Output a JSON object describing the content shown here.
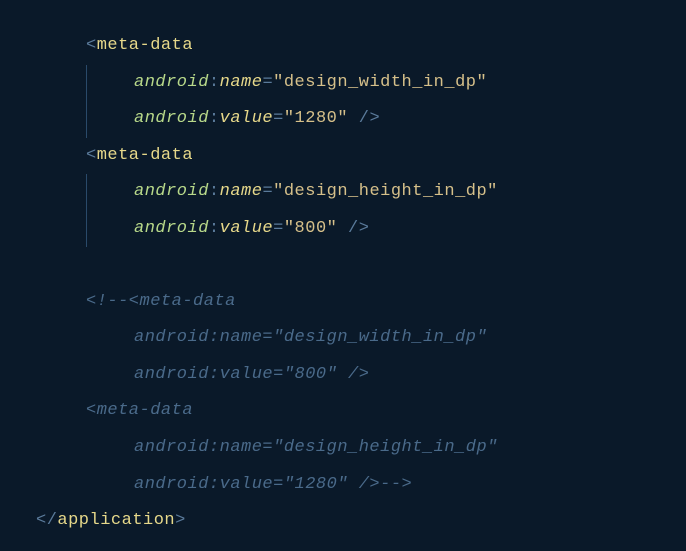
{
  "code": {
    "lines": [
      {
        "indent": 1,
        "vbar": false,
        "segments": [
          {
            "cls": "punct",
            "t": "<"
          },
          {
            "cls": "tag",
            "t": "meta-data"
          }
        ]
      },
      {
        "indent": 2,
        "vbar": true,
        "segments": [
          {
            "cls": "ns",
            "t": "android"
          },
          {
            "cls": "punct",
            "t": ":"
          },
          {
            "cls": "attr",
            "t": "name"
          },
          {
            "cls": "eq",
            "t": "="
          },
          {
            "cls": "str",
            "t": "\"design_width_in_dp\""
          }
        ]
      },
      {
        "indent": 2,
        "vbar": true,
        "segments": [
          {
            "cls": "ns",
            "t": "android"
          },
          {
            "cls": "punct",
            "t": ":"
          },
          {
            "cls": "attr",
            "t": "value"
          },
          {
            "cls": "eq",
            "t": "="
          },
          {
            "cls": "str",
            "t": "\"1280\""
          },
          {
            "cls": "punct",
            "t": " />"
          }
        ]
      },
      {
        "indent": 1,
        "vbar": false,
        "segments": [
          {
            "cls": "punct",
            "t": "<"
          },
          {
            "cls": "tag",
            "t": "meta-data"
          }
        ]
      },
      {
        "indent": 2,
        "vbar": true,
        "segments": [
          {
            "cls": "ns",
            "t": "android"
          },
          {
            "cls": "punct",
            "t": ":"
          },
          {
            "cls": "attr",
            "t": "name"
          },
          {
            "cls": "eq",
            "t": "="
          },
          {
            "cls": "str",
            "t": "\"design_height_in_dp\""
          }
        ]
      },
      {
        "indent": 2,
        "vbar": true,
        "segments": [
          {
            "cls": "ns",
            "t": "android"
          },
          {
            "cls": "punct",
            "t": ":"
          },
          {
            "cls": "attr",
            "t": "value"
          },
          {
            "cls": "eq",
            "t": "="
          },
          {
            "cls": "str",
            "t": "\"800\""
          },
          {
            "cls": "punct",
            "t": " />"
          }
        ]
      },
      {
        "indent": 1,
        "vbar": false,
        "segments": [
          {
            "cls": "punct",
            "t": " "
          }
        ]
      },
      {
        "indent": 1,
        "vbar": false,
        "segments": [
          {
            "cls": "comment",
            "t": "<!--<meta-data"
          }
        ]
      },
      {
        "indent": 2,
        "vbar": false,
        "segments": [
          {
            "cls": "comment",
            "t": "android:name=\"design_width_in_dp\""
          }
        ]
      },
      {
        "indent": 2,
        "vbar": false,
        "segments": [
          {
            "cls": "comment",
            "t": "android:value=\"800\" />"
          }
        ]
      },
      {
        "indent": 1,
        "vbar": false,
        "segments": [
          {
            "cls": "comment",
            "t": "<meta-data"
          }
        ]
      },
      {
        "indent": 2,
        "vbar": false,
        "segments": [
          {
            "cls": "comment",
            "t": "android:name=\"design_height_in_dp\""
          }
        ]
      },
      {
        "indent": 2,
        "vbar": false,
        "segments": [
          {
            "cls": "comment",
            "t": "android:value=\"1280\" />-->"
          }
        ]
      },
      {
        "indent": 0,
        "vbar": false,
        "segments": [
          {
            "cls": "punct",
            "t": "</"
          },
          {
            "cls": "tag",
            "t": "application"
          },
          {
            "cls": "punct",
            "t": ">"
          }
        ]
      }
    ]
  }
}
